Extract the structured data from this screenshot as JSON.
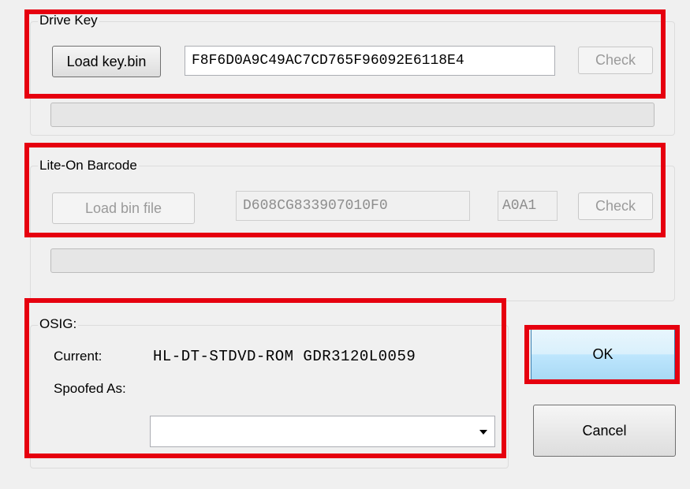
{
  "drive_key": {
    "legend": "Drive Key",
    "load_button": "Load key.bin",
    "key_value": "F8F6D0A9C49AC7CD765F96092E6118E4",
    "check_button": "Check"
  },
  "liteon": {
    "legend": "Lite-On Barcode",
    "load_button": "Load bin file",
    "barcode_value": "D608CG833907010F0",
    "code_value": "A0A1",
    "check_button": "Check"
  },
  "osig": {
    "legend": "OSIG:",
    "current_label": "Current:",
    "current_value": "HL-DT-STDVD-ROM GDR3120L0059",
    "spoofed_label": "Spoofed As:",
    "spoofed_value": ""
  },
  "buttons": {
    "ok": "OK",
    "cancel": "Cancel"
  },
  "colors": {
    "highlight": "#e6000f",
    "window_bg": "#f0f0f0"
  }
}
